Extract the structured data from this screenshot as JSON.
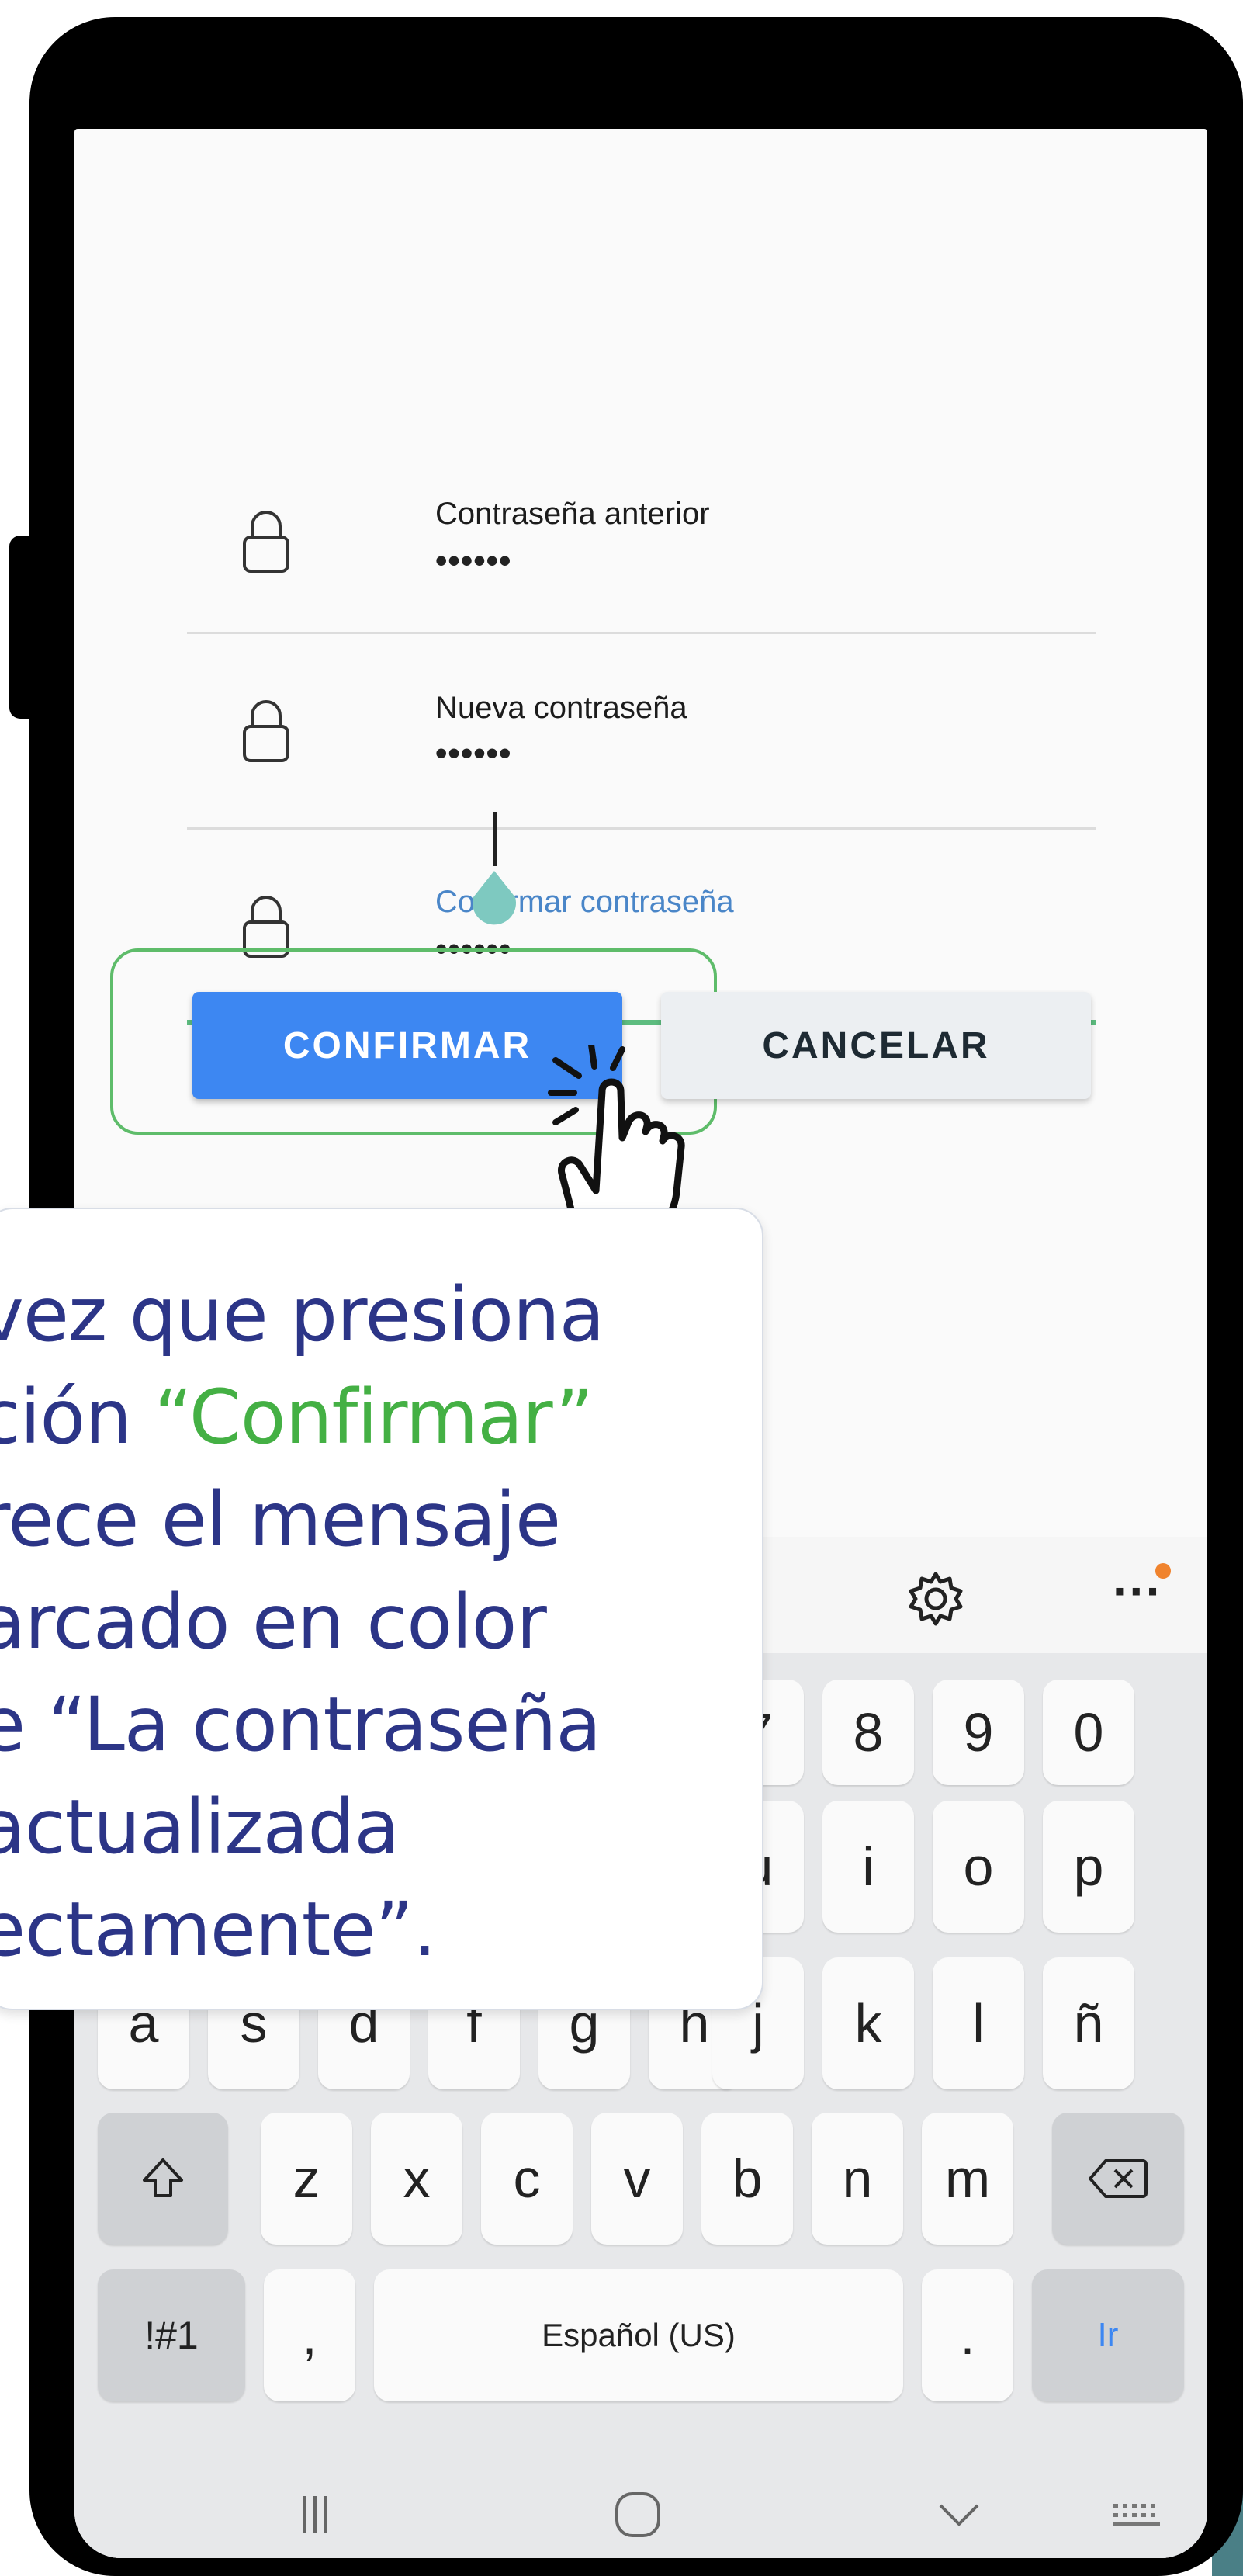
{
  "form": {
    "old_password": {
      "label": "Contraseña anterior",
      "value": "••••••"
    },
    "new_password": {
      "label": "Nueva contraseña",
      "value": "••••••"
    },
    "confirm_password": {
      "label": "Confirmar contraseña",
      "value": "••••••"
    },
    "confirm_button": "CONFIRMAR",
    "cancel_button": "CANCELAR"
  },
  "callout": {
    "line1": "vez que presiona",
    "line2_pre": "ción ",
    "line2_highlight": "“Confirmar”",
    "line3": "rece el mensaje",
    "line4": "arcado en color",
    "line5": "e “La contraseña",
    "line6": "actualizada",
    "line7": "ectamente”."
  },
  "keyboard": {
    "icons": [
      "microphone-icon",
      "settings-icon",
      "more-icon"
    ],
    "row_numbers_visible": [
      "7",
      "8",
      "9",
      "0"
    ],
    "row_top_visible": [
      "u",
      "i",
      "o",
      "p"
    ],
    "row_middle": [
      "a",
      "s",
      "d",
      "f",
      "g",
      "h",
      "j",
      "k",
      "l",
      "ñ"
    ],
    "row_bottom": [
      "z",
      "x",
      "c",
      "v",
      "b",
      "n",
      "m"
    ],
    "symbols_key": "!#1",
    "comma_key": ",",
    "space_label": "Español (US)",
    "period_key": ".",
    "enter_key": "Ir"
  },
  "colors": {
    "primary_button": "#3d87f2",
    "focus_line": "#5dbc7f",
    "callout_text": "#2c3587",
    "callout_highlight": "#44b044"
  }
}
